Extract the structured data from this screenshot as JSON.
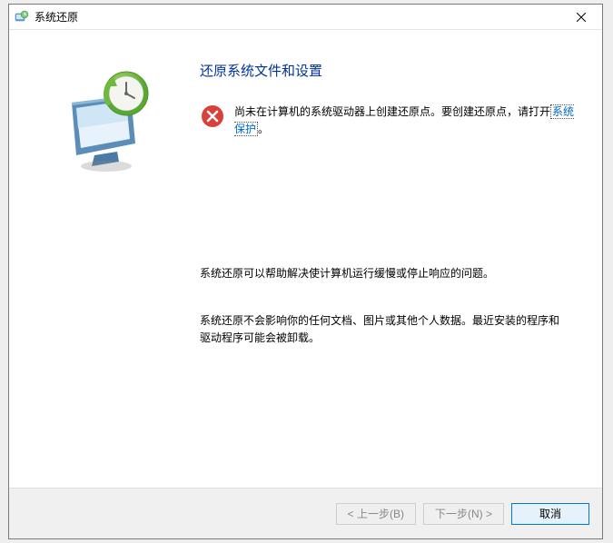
{
  "window": {
    "title": "系统还原"
  },
  "main": {
    "heading": "还原系统文件和设置",
    "error": {
      "prefix": "尚未在计算机的系统驱动器上创建还原点。要创建还原点，请打开",
      "link": "系统保护",
      "suffix": "。"
    },
    "para1": "系统还原可以帮助解决使计算机运行缓慢或停止响应的问题。",
    "para2": "系统还原不会影响你的任何文档、图片或其他个人数据。最近安装的程序和驱动程序可能会被卸载。"
  },
  "footer": {
    "back": "< 上一步(B)",
    "next": "下一步(N) >",
    "cancel": "取消"
  }
}
